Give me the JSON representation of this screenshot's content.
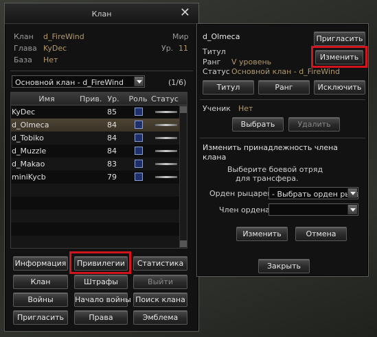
{
  "clan_window": {
    "title": "Клан",
    "info": {
      "clan_label": "Клан",
      "clan_value": "d_FireWind",
      "leader_label": "Глава",
      "leader_value": "KyDec",
      "base_label": "База",
      "base_value": "Нет",
      "world_label": "Мир",
      "level_label": "Ур.",
      "level_value": "11"
    },
    "subclan_select": "Основной клан - d_FireWind",
    "page_counter": "(1/6)",
    "table": {
      "headers": [
        "Имя",
        "Прив.",
        "Ур.",
        "Роль",
        "Статус"
      ],
      "rows": [
        {
          "name": "KyDec",
          "priv": "",
          "level": "85"
        },
        {
          "name": "d_Olmeca",
          "priv": "",
          "level": "84"
        },
        {
          "name": "d_Tobiko",
          "priv": "",
          "level": "84"
        },
        {
          "name": "d_Muzzle",
          "priv": "",
          "level": "84"
        },
        {
          "name": "d_Makao",
          "priv": "",
          "level": "83"
        },
        {
          "name": "miniKycb",
          "priv": "",
          "level": "79"
        }
      ]
    },
    "buttons": {
      "info": "Информация",
      "privileges": "Привилегии",
      "stats": "Статистика",
      "clan": "Клан",
      "penalties": "Штрафы",
      "leave": "Выйти",
      "wars": "Войны",
      "start_war": "Начало войны",
      "search_clan": "Поиск клана",
      "invite": "Пригласить",
      "rights": "Права",
      "emblem": "Эмблема"
    }
  },
  "member_panel": {
    "name": "d_Olmeca",
    "invite_button": "Пригласить",
    "title_label": "Титул",
    "edit_button": "Изменить",
    "rank_label": "Ранг",
    "rank_value": "V уровень",
    "status_label": "Статус",
    "status_value": "Основной клан - d_FireWind",
    "title_button": "Титул",
    "rank_button": "Ранг",
    "kick_button": "Исключить",
    "student_label": "Ученик",
    "student_value": "Нет",
    "choose_button": "Выбрать",
    "delete_button": "Удалить",
    "affiliation_heading": "Изменить принадлежность члена клана",
    "affiliation_hint_1": "Выберите боевой отряд",
    "affiliation_hint_2": "для трансфера.",
    "order_label": "Орден рыцарей:",
    "order_select": "- Выбрать орден рыцарей",
    "member_label": "Член ордена:",
    "member_select": "",
    "change_button": "Изменить",
    "cancel_button": "Отмена",
    "close_button": "Закрыть"
  },
  "colors": {
    "highlight": "#d2141e",
    "value_text": "#b4996a"
  }
}
